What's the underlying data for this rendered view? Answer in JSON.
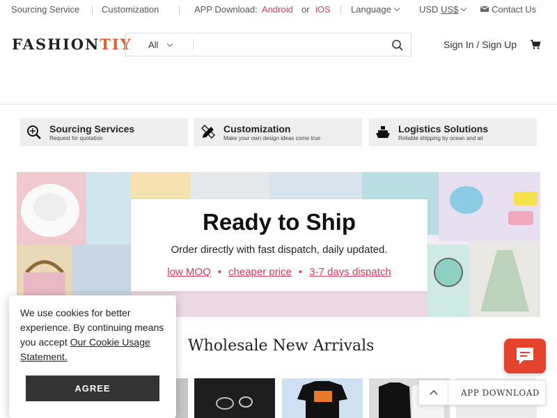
{
  "topbar": {
    "sourcing": "Sourcing Service",
    "customization": "Customization",
    "app_label": "APP Download:",
    "android": "Android",
    "or": "or",
    "ios": "iOS",
    "language": "Language",
    "currency_prefix": "USD",
    "currency_value": "US$",
    "contact": "Contact Us"
  },
  "header": {
    "logo_main": "FASHION",
    "logo_accent": "TIY",
    "search_category": "All",
    "search_placeholder": "",
    "signin": "Sign In / Sign Up"
  },
  "services": [
    {
      "title": "Sourcing Services",
      "subtitle": "Request for quotation",
      "icon": "search-sourcing-icon"
    },
    {
      "title": "Customization",
      "subtitle": "Make your own design ideas come true",
      "icon": "pencil-ruler-icon"
    },
    {
      "title": "Logistics Solutions",
      "subtitle": "Reliable shipping by ocean and air",
      "icon": "ship-icon"
    }
  ],
  "banner": {
    "heading": "Ready to Ship",
    "subheading": "Order directly with fast dispatch, daily updated.",
    "features": [
      "low MOQ",
      "cheaper price",
      "3-7 days dispatch"
    ]
  },
  "section_title": "Wholesale New Arrivals",
  "cookie": {
    "message": "We use cookies for better experience. By continuing means you accept",
    "link": "Our Cookie Usage Statement.",
    "button": "AGREE"
  },
  "app_download": "APP DOWNLOAD",
  "colors": {
    "accent": "#e0375b",
    "logo_accent": "#e65a2e",
    "chat": "#e5432d",
    "agree_button": "#333333"
  }
}
